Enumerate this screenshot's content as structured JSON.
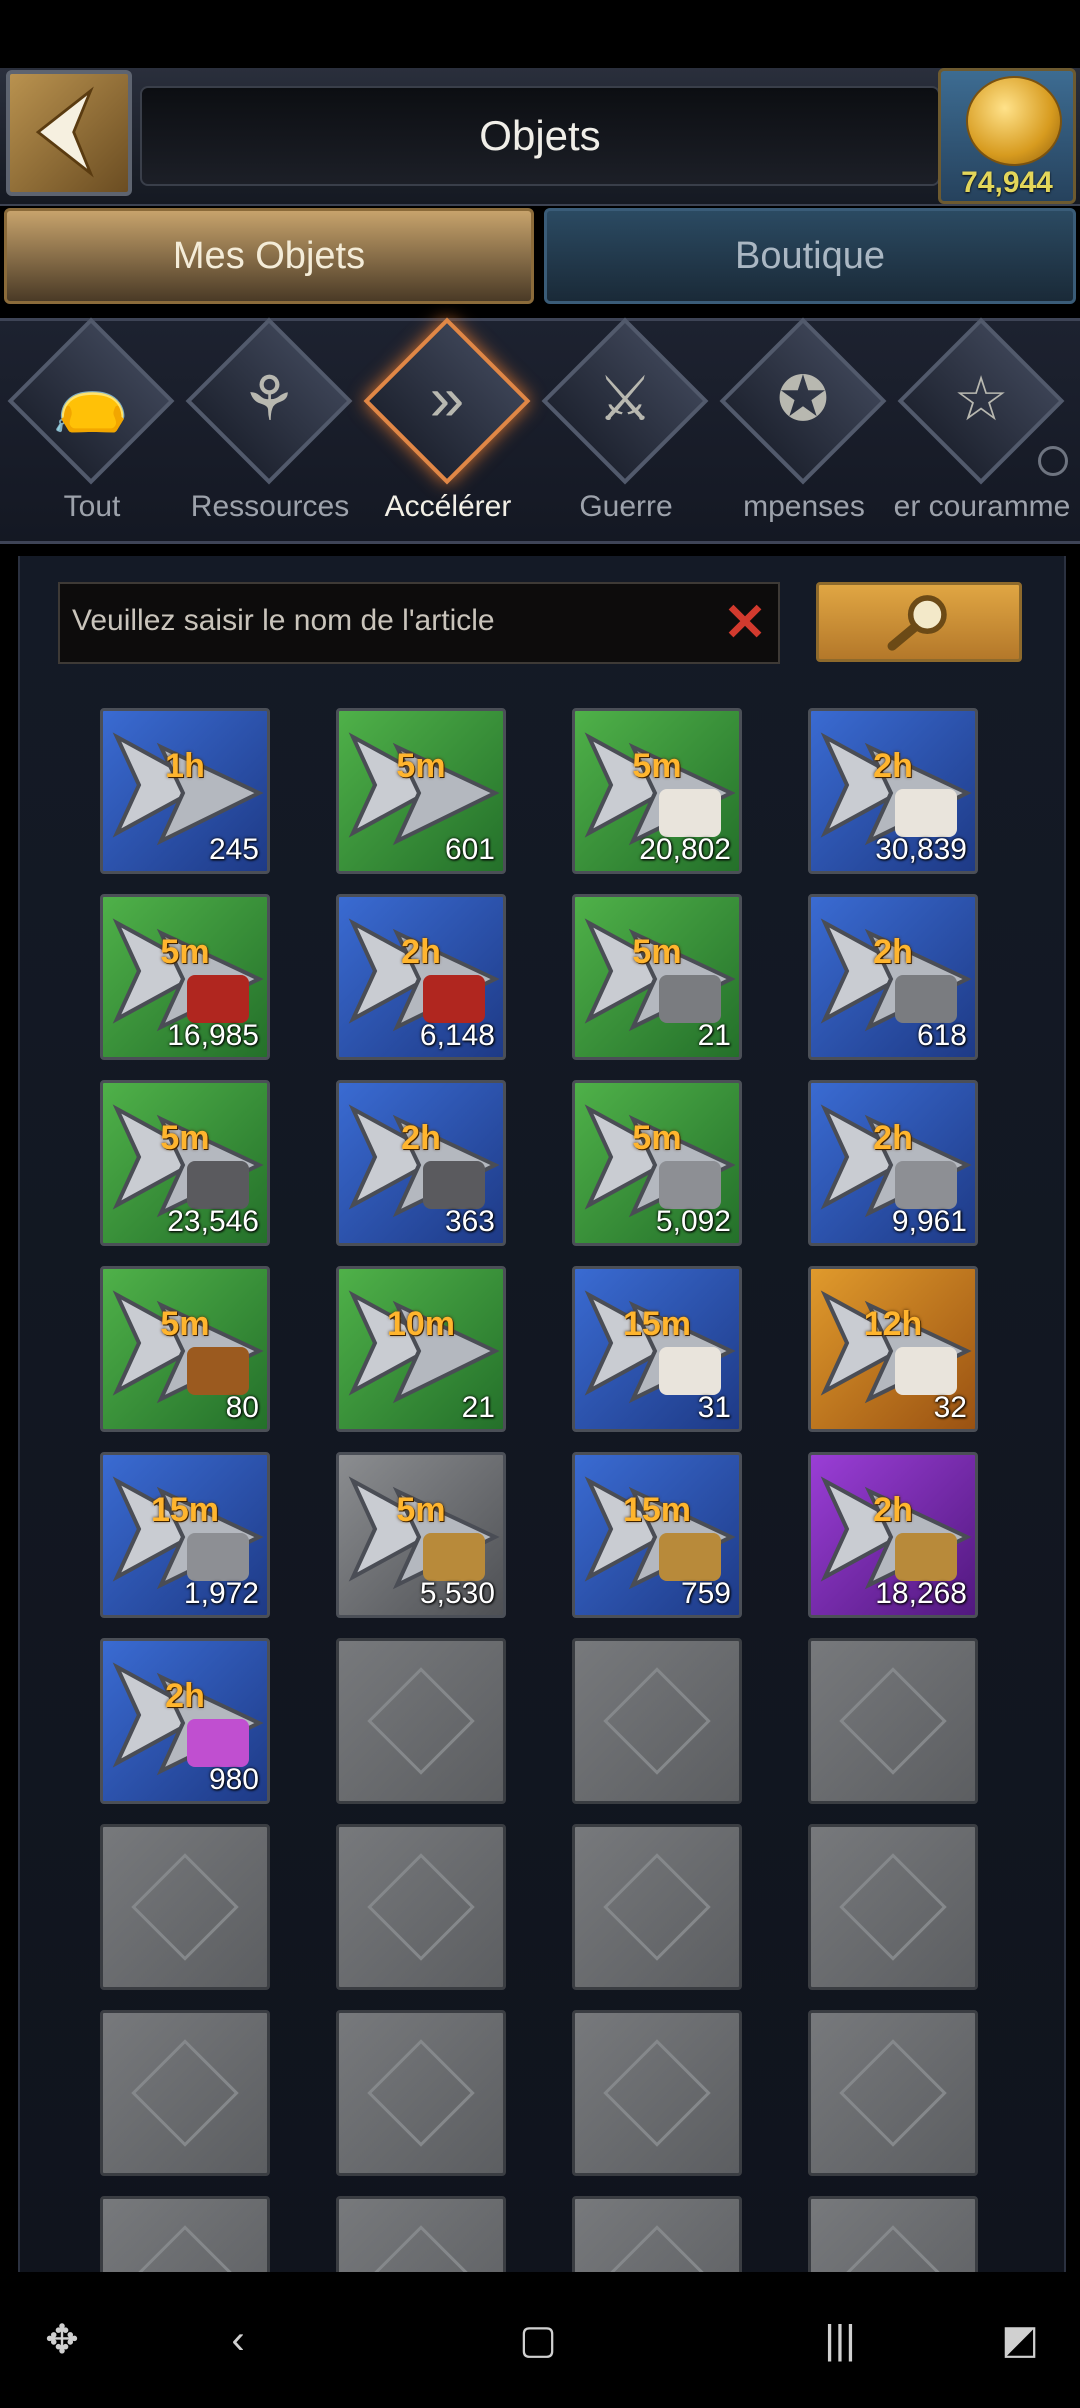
{
  "header": {
    "title": "Objets",
    "gold_amount": "74,944"
  },
  "tabs": [
    {
      "label": "Mes Objets",
      "active": true
    },
    {
      "label": "Boutique",
      "active": false
    }
  ],
  "categories": [
    {
      "label": "Tout",
      "icon": "bag-icon"
    },
    {
      "label": "Ressources",
      "icon": "wheat-icon"
    },
    {
      "label": "Accélérer",
      "icon": "speedup-icon",
      "active": true
    },
    {
      "label": "Guerre",
      "icon": "crossed-swords-icon"
    },
    {
      "label": "mpenses",
      "icon": "reward-star-icon"
    },
    {
      "label": "er couramme",
      "icon": "star-icon"
    }
  ],
  "search": {
    "placeholder": "Veuillez saisir le nom de l'article"
  },
  "items": [
    {
      "duration": "1h",
      "quantity": "245",
      "rarity": "blue",
      "badge": ""
    },
    {
      "duration": "5m",
      "quantity": "601",
      "rarity": "green",
      "badge": ""
    },
    {
      "duration": "5m",
      "quantity": "20,802",
      "rarity": "green",
      "badge": "medical-flag-icon"
    },
    {
      "duration": "2h",
      "quantity": "30,839",
      "rarity": "blue",
      "badge": "medical-flag-icon"
    },
    {
      "duration": "5m",
      "quantity": "16,985",
      "rarity": "green",
      "badge": "training-cart-icon"
    },
    {
      "duration": "2h",
      "quantity": "6,148",
      "rarity": "blue",
      "badge": "training-cart-icon"
    },
    {
      "duration": "5m",
      "quantity": "21",
      "rarity": "green",
      "badge": "wall-icon"
    },
    {
      "duration": "2h",
      "quantity": "618",
      "rarity": "blue",
      "badge": "wall-icon"
    },
    {
      "duration": "5m",
      "quantity": "23,546",
      "rarity": "green",
      "badge": "anvil-icon"
    },
    {
      "duration": "2h",
      "quantity": "363",
      "rarity": "blue",
      "badge": "anvil-icon"
    },
    {
      "duration": "5m",
      "quantity": "5,092",
      "rarity": "green",
      "badge": "hammer-icon"
    },
    {
      "duration": "2h",
      "quantity": "9,961",
      "rarity": "blue",
      "badge": "hammer-icon"
    },
    {
      "duration": "5m",
      "quantity": "80",
      "rarity": "green",
      "badge": "chest-icon"
    },
    {
      "duration": "10m",
      "quantity": "21",
      "rarity": "green",
      "badge": ""
    },
    {
      "duration": "15m",
      "quantity": "31",
      "rarity": "blue",
      "badge": "medical-flag-icon"
    },
    {
      "duration": "12h",
      "quantity": "32",
      "rarity": "orange",
      "badge": "medical-flag-icon"
    },
    {
      "duration": "15m",
      "quantity": "1,972",
      "rarity": "blue",
      "badge": "hammer-icon"
    },
    {
      "duration": "5m",
      "quantity": "5,530",
      "rarity": "gray",
      "badge": "armillary-icon"
    },
    {
      "duration": "15m",
      "quantity": "759",
      "rarity": "blue",
      "badge": "armillary-icon"
    },
    {
      "duration": "2h",
      "quantity": "18,268",
      "rarity": "purple",
      "badge": "armillary-icon"
    },
    {
      "duration": "2h",
      "quantity": "980",
      "rarity": "blue",
      "badge": "crystal-icon"
    }
  ],
  "empty_slots": 15,
  "colors": {
    "duration_text": "#ffb52e",
    "gold_text": "#e3d65a",
    "active_category_glow": "#e08746",
    "clear_x": "#d23a2e"
  },
  "navbar": {
    "icons": [
      "game-launcher-icon",
      "back-icon",
      "home-icon",
      "recents-icon",
      "assist-icon"
    ]
  }
}
